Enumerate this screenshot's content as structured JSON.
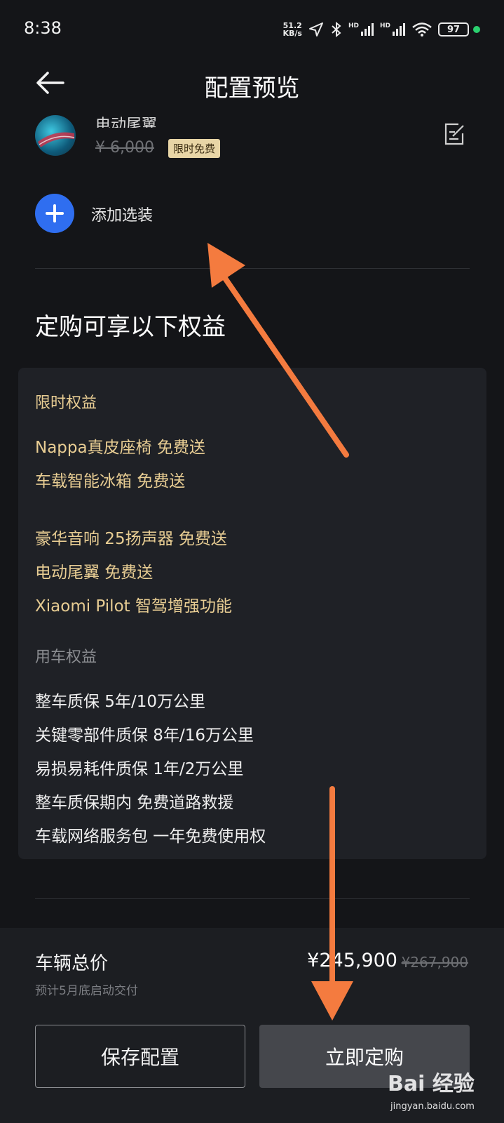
{
  "status_bar": {
    "time": "8:38",
    "net_speed_value": "51.2",
    "net_speed_unit": "KB/s",
    "signal1_label": "HD",
    "signal2_label": "HD",
    "battery": "97",
    "icons": [
      "location-arrow-icon",
      "bluetooth-icon",
      "signal-icon",
      "signal-icon",
      "wifi-icon",
      "battery-icon"
    ]
  },
  "header": {
    "title": "配置预览",
    "back_icon": "arrow-left-icon"
  },
  "option_item": {
    "name": "电动尾翼",
    "original_price": "¥ 6,000",
    "badge": "限时免费",
    "edit_icon": "edit-icon"
  },
  "add_option": {
    "label": "添加选装",
    "icon": "plus-icon",
    "icon_bg": "#2f6ef0"
  },
  "benefits": {
    "heading": "定购可享以下权益",
    "limited_title": "限时权益",
    "limited_items": [
      "Nappa真皮座椅 免费送",
      "车载智能冰箱 免费送",
      "豪华音响 25扬声器 免费送",
      "电动尾翼 免费送",
      "Xiaomi Pilot 智驾增强功能"
    ],
    "usage_title": "用车权益",
    "usage_items": [
      "整车质保 5年/10万公里",
      "关键零部件质保 8年/16万公里",
      "易损易耗件质保 1年/2万公里",
      "整车质保期内 免费道路救援",
      "车载网络服务包 一年免费使用权"
    ],
    "gold_color": "#e8cd93"
  },
  "footer": {
    "total_label": "车辆总价",
    "delivery_note": "预计5月底启动交付",
    "price_current": "¥245,900",
    "price_original": "¥267,900",
    "save_button": "保存配置",
    "order_button": "立即定购"
  },
  "annotations": {
    "arrow_color": "#f47b3f"
  },
  "watermark": {
    "brand": "Bai 经验",
    "url": "jingyan.baidu.com"
  }
}
